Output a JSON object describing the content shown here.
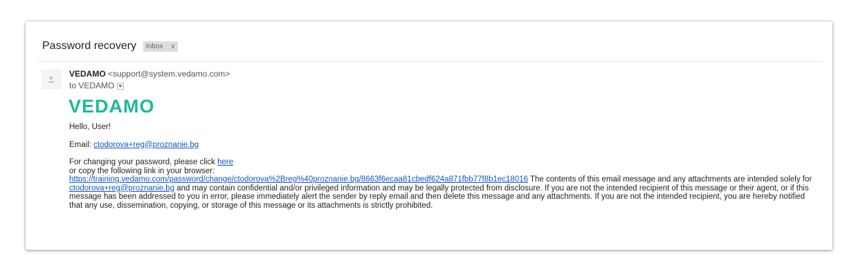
{
  "email": {
    "subject": "Password recovery",
    "label": {
      "text": "Inbox",
      "close": "x"
    },
    "sender_name": "VEDAMO",
    "sender_address": "<support@system.vedamo.com>",
    "to_line": "to VEDAMO",
    "logo_text": "VEDAMO",
    "greeting": "Hello, User!",
    "email_label": "Email:",
    "email_link": "ctodorova+reg@proznanie.bg",
    "change_text": "For changing your password, please click",
    "here_link": "here",
    "copy_text": "or copy the following link in your browser:",
    "reset_link": "https://training.vedamo.com/password/change/ctodorova%2Breg%40proznanie.bg/8663f6ecaa81cbedf624a871fbb77f8b1ec18016",
    "disclaimer_part1": " The contents of this email message and any attachments are intended solely for",
    "disclaimer_email_link": "ctodorova+reg@proznanie.bg",
    "disclaimer_part2": " and may contain confidential and/or privileged information and may be legally protected from disclosure. If you are not the intended recipient of this message or their agent, or if this message has been addressed to you in error, please immediately alert the sender by reply email and then delete this message and any attachments. If you are not the intended recipient, you are hereby notified that any use, dissemination, copying, or storage of this message or its attachments is strictly prohibited."
  },
  "colors": {
    "logo": "#1fb89a",
    "link": "#1155cc",
    "label_bg": "#dddddd"
  },
  "icons": {
    "avatar": "person-icon",
    "dropdown": "chevron-down-icon"
  }
}
